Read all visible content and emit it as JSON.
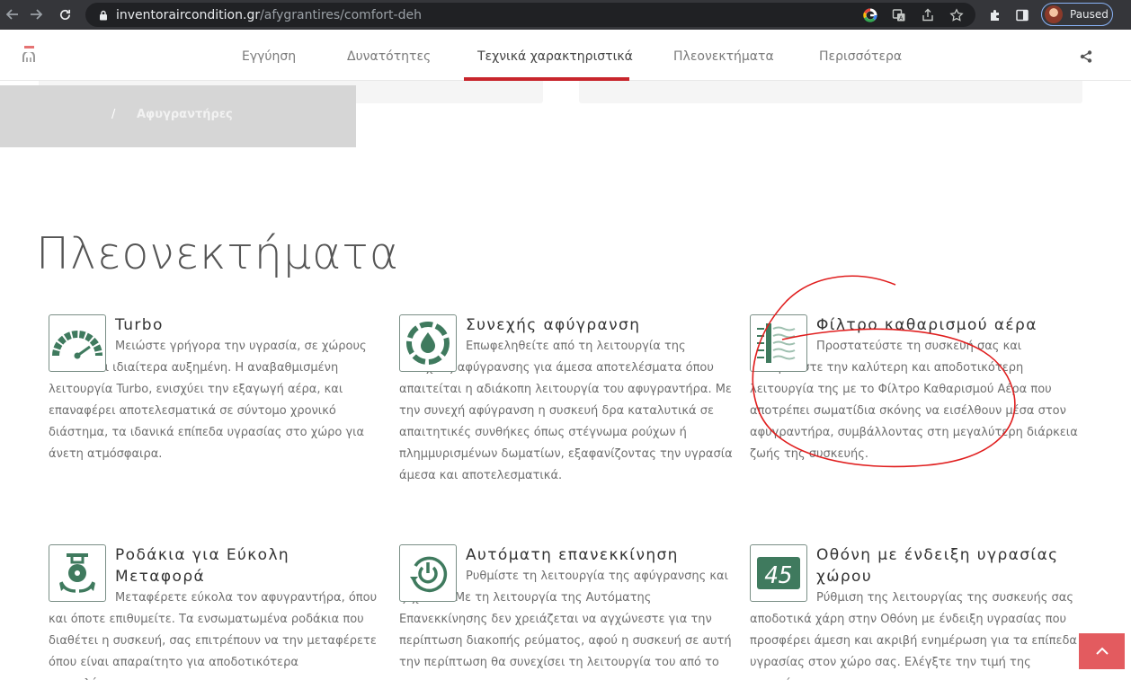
{
  "browser": {
    "url_domain": "inventoraircondition.gr",
    "url_path": "/afygrantires/comfort-deh",
    "profile_status": "Paused"
  },
  "nav": {
    "tabs": [
      {
        "label": "Εγγύηση"
      },
      {
        "label": "Δυνατότητες"
      },
      {
        "label": "Τεχνικά χαρακτηριστικά"
      },
      {
        "label": "Πλεονεκτήματα"
      },
      {
        "label": "Περισσότερα"
      }
    ],
    "active_tab": "Τεχνικά χαρακτηριστικά"
  },
  "breadcrumb": {
    "separator": "/",
    "current": "Αφυγραντήρες"
  },
  "section": {
    "title": "Πλεονεκτήματα"
  },
  "features": [
    {
      "title": "Turbo",
      "text": "Μειώστε γρήγορα την υγρασία, σε χώρους όπου είναι ιδιαίτερα αυξημένη. Η αναβαθμισμένη λειτουργία Turbo, ενισχύει την εξαγωγή αέρα, και επαναφέρει αποτελεσματικά σε σύντομο χρονικό διάστημα, τα ιδανικά επίπεδα υγρασίας στο χώρο για άνετη ατμόσφαιρα.",
      "icon": "speedometer-icon"
    },
    {
      "title": "Συνεχής αφύγρανση",
      "text": "Επωφεληθείτε από τη λειτουργία της συνεχούς αφύγρανσης για άμεσα αποτελέσματα όπου απαιτείται η αδιάκοπη λειτουργία του αφυγραντήρα. Με την συνεχή αφύγρανση η συσκευή δρα καταλυτικά σε απαιτητικές συνθήκες όπως στέγνωμα ρούχων ή πλημμυρισμένων δωματίων, εξαφανίζοντας την υγρασία άμεσα και αποτελεσματικά.",
      "icon": "water-drop-cycle-icon"
    },
    {
      "title": "Φίλτρο καθαρισμού αέρα",
      "text": "Προστατεύστε τη συσκευή σας και διασφαλίστε την καλύτερη και αποδοτικότερη λειτουργία της με το Φίλτρο Καθαρισμού Αέρα που αποτρέπει σωματίδια σκόνης να εισέλθουν μέσα στον αφυγραντήρα, συμβάλλοντας στη μεγαλύτερη διάρκεια ζωής της συσκευής.",
      "icon": "air-filter-icon"
    },
    {
      "title": "Ροδάκια για Εύκολη Μεταφορά",
      "text": "Μεταφέρετε εύκολα τον αφυγραντήρα, όπου και όποτε επιθυμείτε. Τα ενσωματωμένα ροδάκια που διαθέτει η συσκευή, σας επιτρέπουν να την μεταφέρετε όπου είναι απαραίτητο για αποδοτικότερα αποτελέσματα.",
      "icon": "caster-wheel-icon"
    },
    {
      "title": "Αυτόματη επανεκκίνηση",
      "text": "Ρυθμίστε τη λειτουργία της αφύγρανσης και ξεχνάτε! Με τη λειτουργία της Αυτόματης Επανεκκίνησης δεν χρειάζεται να αγχώνεστε για την περίπτωση διακοπής ρεύματος, αφού η συσκευή σε αυτή την περίπτωση θα συνεχίσει τη λειτουργία του από το",
      "icon": "power-restart-icon"
    },
    {
      "title": "Οθόνη με ένδειξη υγρασίας χώρου",
      "text": "Ρύθμιση της λειτουργίας της συσκευής σας αποδοτικά χάρη στην Οθόνη με ένδειξη υγρασίας που προσφέρει άμεση και ακριβή ενημέρωση για τα επίπεδα υγρασίας στον χώρο σας. Ελέγξτε την τιμή της υγρασίας",
      "icon": "humidity-display-icon",
      "display_value": "45"
    }
  ],
  "colors": {
    "accent_red": "#c8252c",
    "icon_green": "#3f7a5e",
    "scroll_button": "#e35b5f",
    "annotation_red": "#e01e1e"
  }
}
